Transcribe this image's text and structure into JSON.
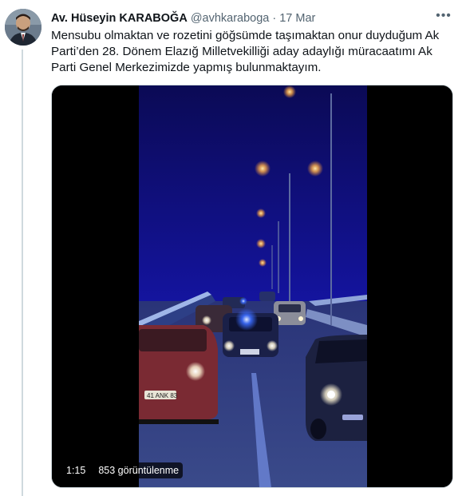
{
  "tweet": {
    "author_name": "Av. Hüseyin KARABOĞA",
    "handle": "@avhkaraboga",
    "separator": "·",
    "date": "17 Mar",
    "more_label": "•••",
    "text_lines": [
      "Mensubu olmaktan ve rozetini göğsümde taşımaktan onur duyduğum Ak",
      "Parti’den 28. Dönem Elazığ Milletvekilliği aday adaylığı müracaatımı Ak",
      "Parti Genel Merkezimizde yapmış bulunmaktayım."
    ]
  },
  "video": {
    "duration": "1:15",
    "views": "853 görüntülenme",
    "plate_text": "41 ANK 83"
  },
  "colors": {
    "accent_blue": "#1d9bf0",
    "text_primary": "#0f1419",
    "text_secondary": "#536471",
    "night_sky": "#0a0a6e",
    "road": "#2b3a7a",
    "headlight": "#fff5d6",
    "police_blue": "#3b6cff"
  }
}
